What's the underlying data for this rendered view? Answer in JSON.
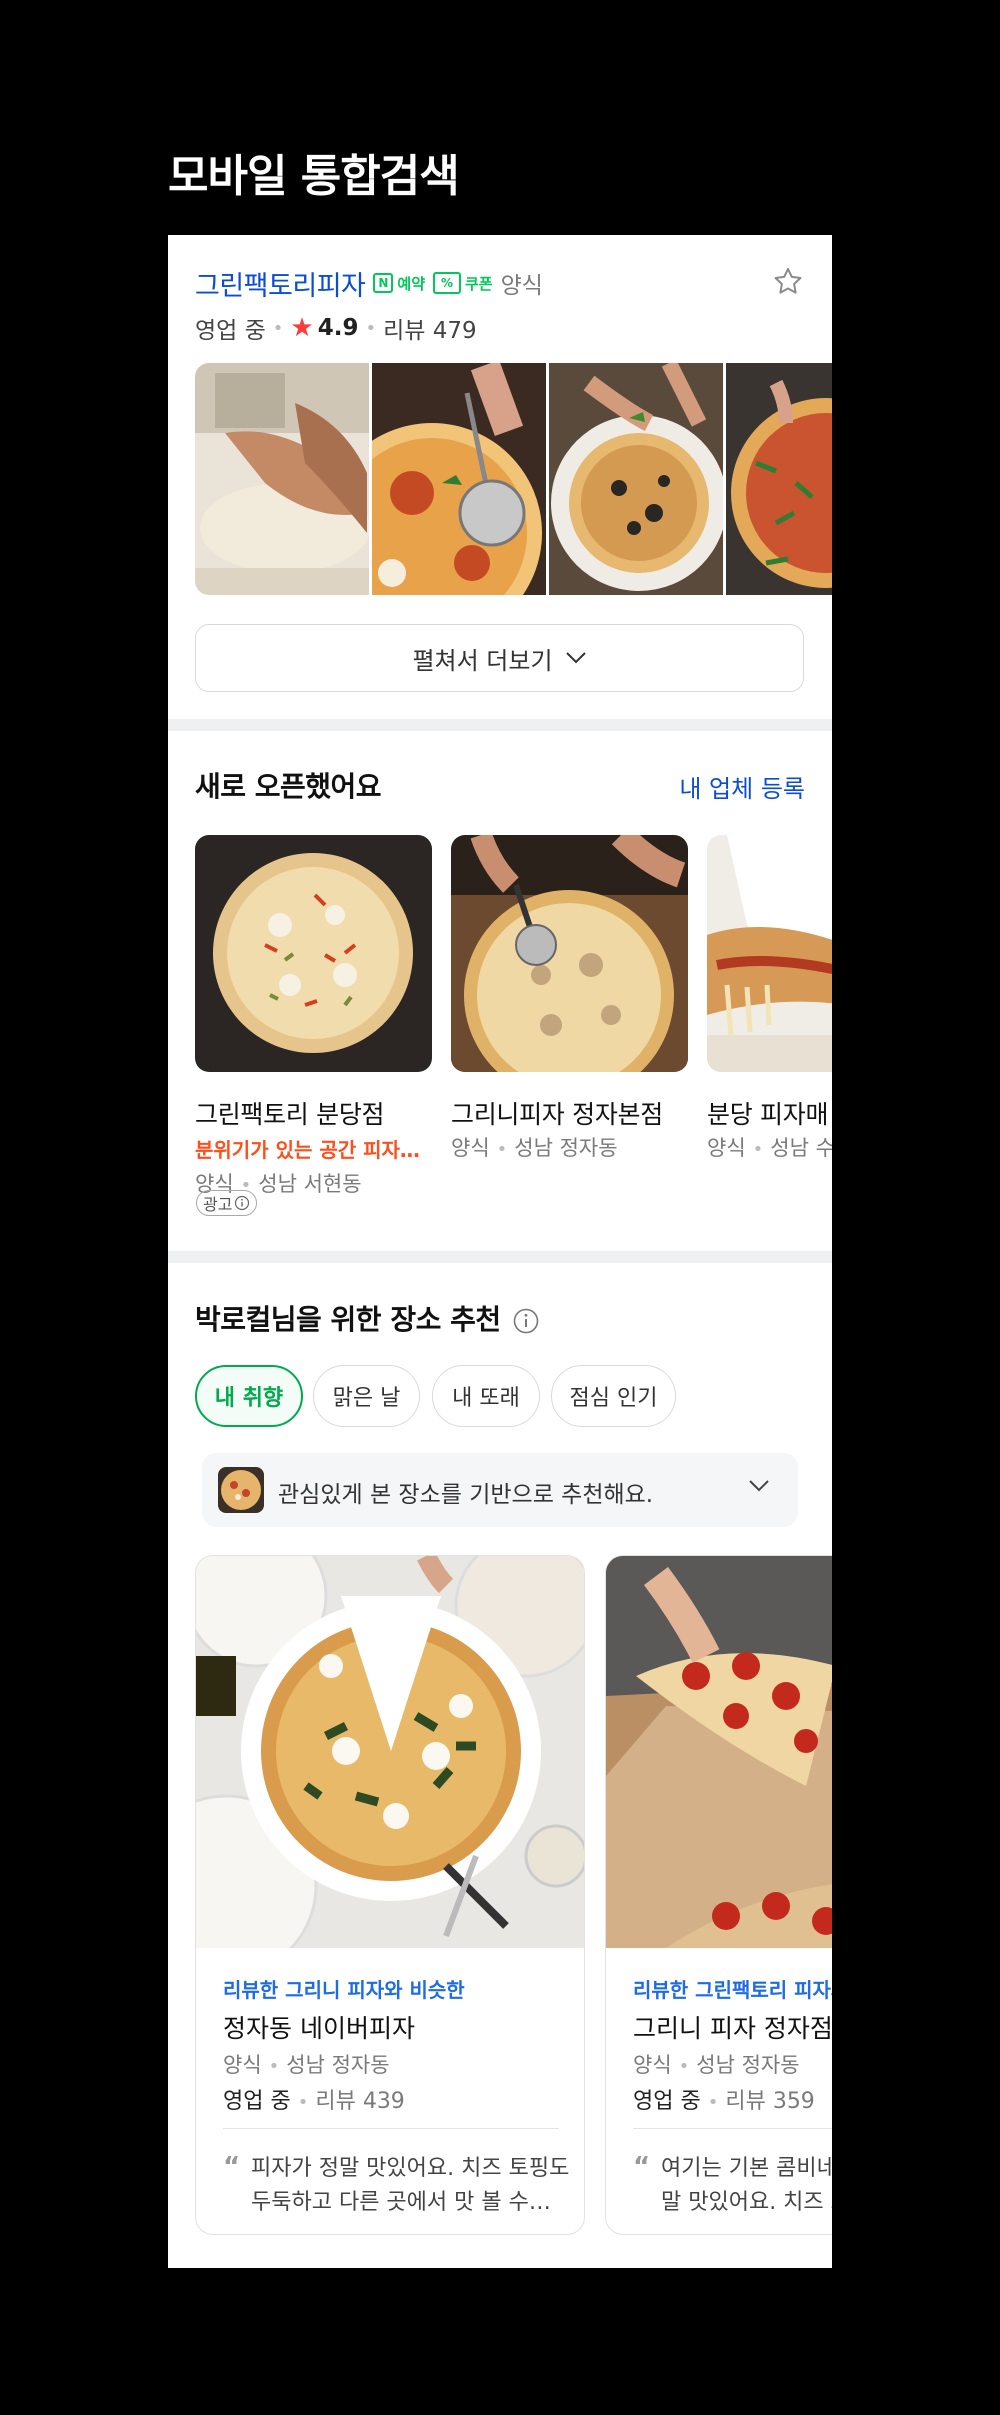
{
  "page": {
    "title": "모바일 통합검색"
  },
  "place": {
    "name": "그린팩토리피자",
    "badge_reserve": "예약",
    "badge_reserve_icon": "N",
    "badge_coupon": "쿠폰",
    "badge_coupon_icon": "%",
    "category": "양식",
    "status": "영업 중",
    "rating": "4.9",
    "review": "리뷰 479",
    "expand_label": "펼쳐서 더보기"
  },
  "new_open": {
    "title": "새로 오픈했어요",
    "link": "내 업체 등록",
    "cards": [
      {
        "name": "그린팩토리 분당점",
        "highlight": "분위기가 있는 공간 피자…",
        "category": "양식",
        "location": "성남 서현동",
        "ad": "광고"
      },
      {
        "name": "그리니피자 정자본점",
        "category": "양식",
        "location": "성남 정자동"
      },
      {
        "name": "분당 피자매",
        "category": "양식",
        "location": "성남 수"
      }
    ]
  },
  "recommend": {
    "title": "박로컬님을 위한 장소 추천",
    "chips": [
      "내 취향",
      "맑은 날",
      "내 또래",
      "점심 인기"
    ],
    "bar_text": "관심있게 본 장소를 기반으로 추천해요.",
    "cards": [
      {
        "tag": "리뷰한 그리니 피자와 비슷한",
        "name": "정자동 네이버피자",
        "category": "양식",
        "location": "성남 정자동",
        "status": "영업 중",
        "review": "리뷰 439",
        "quote_line1": "피자가 정말 맛있어요. 치즈 토핑도",
        "quote_line2": "두둑하고 다른 곳에서 맛 볼 수…"
      },
      {
        "tag": "리뷰한 그린팩토리 피자와",
        "name": "그리니 피자 정자점",
        "category": "양식",
        "location": "성남 정자동",
        "status": "영업 중",
        "review": "리뷰 359",
        "quote_line1": "여기는 기본 콤비네",
        "quote_line2": "말 맛있어요. 치즈 토"
      }
    ]
  },
  "colors": {
    "accent_green": "#03c75a",
    "link_blue": "#0b4ed1",
    "rating_red": "#ff3a3a",
    "highlight_orange": "#ff4e1a"
  }
}
